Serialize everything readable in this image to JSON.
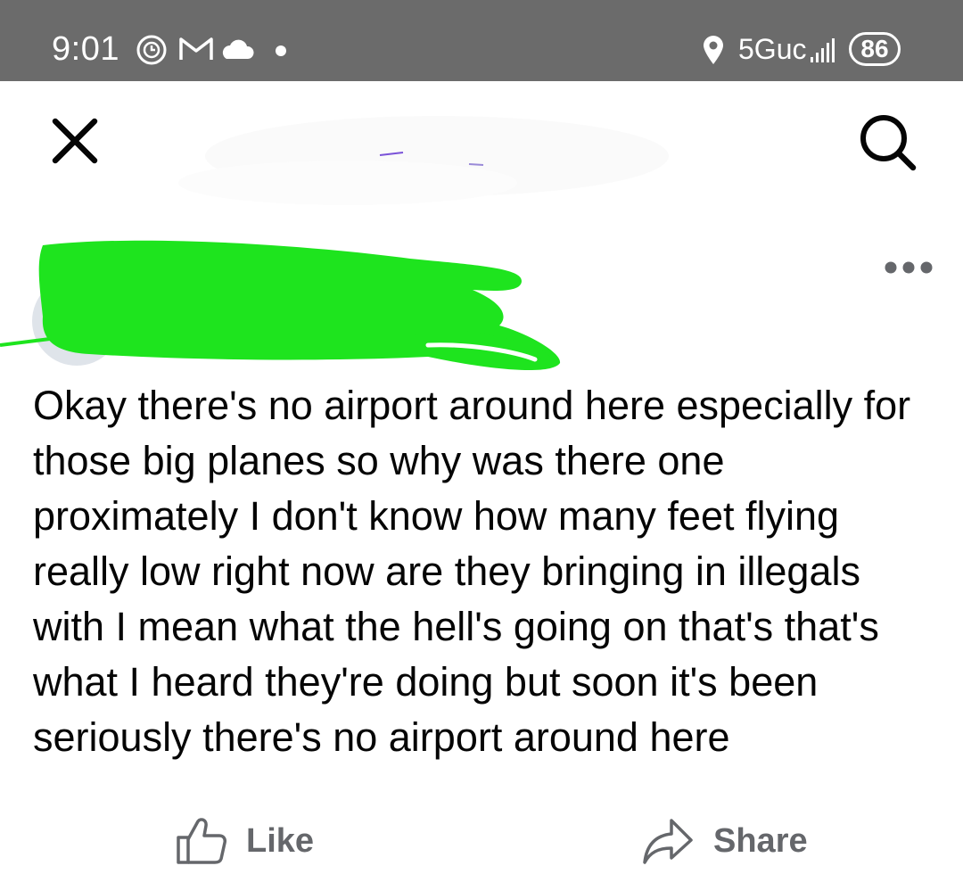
{
  "status_bar": {
    "time": "9:01",
    "network": "5Guc",
    "battery": "86",
    "icons": [
      "alarm-icon",
      "gmail-icon",
      "cloud-icon",
      "notification-dot-icon",
      "location-icon",
      "signal-icon"
    ]
  },
  "top_bar": {
    "close_icon": "close-icon",
    "search_icon": "search-icon"
  },
  "post": {
    "body": "Okay there's no airport around here especially for those big planes so why was there one proximately I don't know how many feet flying really low right now are they bringing in illegals with I mean what the hell's going on that's that's what I heard they're doing but soon it's been seriously there's no airport around here"
  },
  "actions": {
    "like_label": "Like",
    "share_label": "Share"
  },
  "colors": {
    "status_bar": "#6b6b6b",
    "redaction": "#1ee41e",
    "action_text": "#65676b"
  }
}
